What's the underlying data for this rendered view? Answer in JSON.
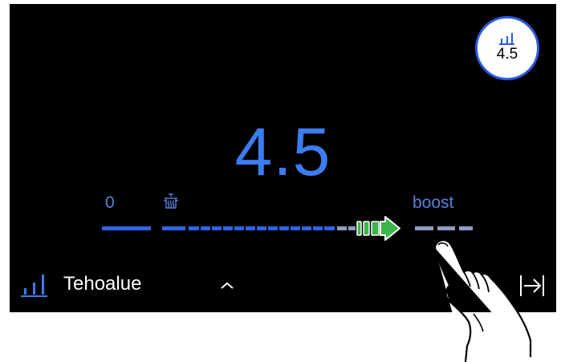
{
  "current_level": "4.5",
  "badge": {
    "icon": "power-level-icon",
    "value": "4.5"
  },
  "scale": {
    "min_label": "0",
    "max_label": "boost",
    "keep_warm_icon": "pot-icon"
  },
  "slider": {
    "level": 4.5,
    "direction_icon": "arrow-right-icon"
  },
  "bottom_bar": {
    "mode_icon": "power-level-icon",
    "mode_label": "Tehoalue",
    "expand_icon": "chevron-up-icon",
    "exit_icon": "exit-arrow-icon"
  },
  "colors": {
    "accent": "#3b7cf0",
    "active_segment": "#2f63e8",
    "inactive_segment": "#8d9cc2",
    "arrow": "#3cb54a",
    "background": "#000000"
  }
}
